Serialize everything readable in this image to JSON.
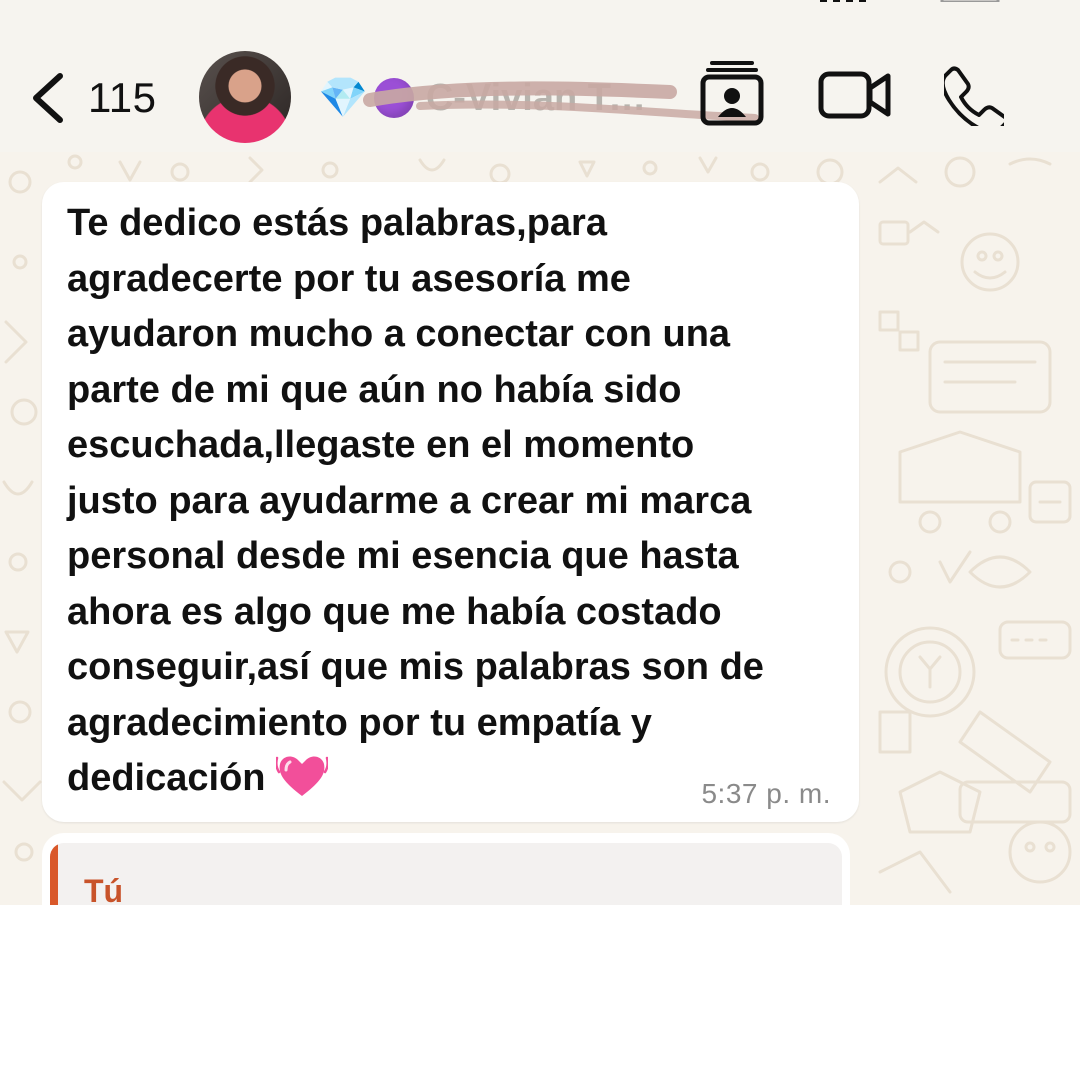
{
  "colors": {
    "header_bg": "#f6f4ef",
    "chat_bg": "#f7f3ec",
    "bubble_bg": "#ffffff",
    "text": "#111111",
    "timestamp": "#8a8a8a",
    "reply_accent": "#d9582a"
  },
  "header": {
    "back_count": "115",
    "contact_name": "C-Vivian Te...",
    "contact_emoji": "💎",
    "icons": [
      "back-chevron-icon",
      "contact-card-icon",
      "video-camera-icon",
      "phone-icon"
    ]
  },
  "messages": [
    {
      "text": "Te dedico estás palabras,para\nagradecerte por tu asesoría me\nayudaron mucho a conectar con una\nparte de mi que aún no había sido\nescuchada,llegaste en el momento\njusto para ayudarme a crear mi marca\npersonal desde mi esencia que hasta\nahora es algo que me había costado\nconseguir,así que mis palabras son de\nagradecimiento por tu empatía y\ndedicación",
      "emoji": "heart-emoji",
      "time": "5:37 p. m."
    },
    {
      "reply_author": "Tú"
    }
  ]
}
